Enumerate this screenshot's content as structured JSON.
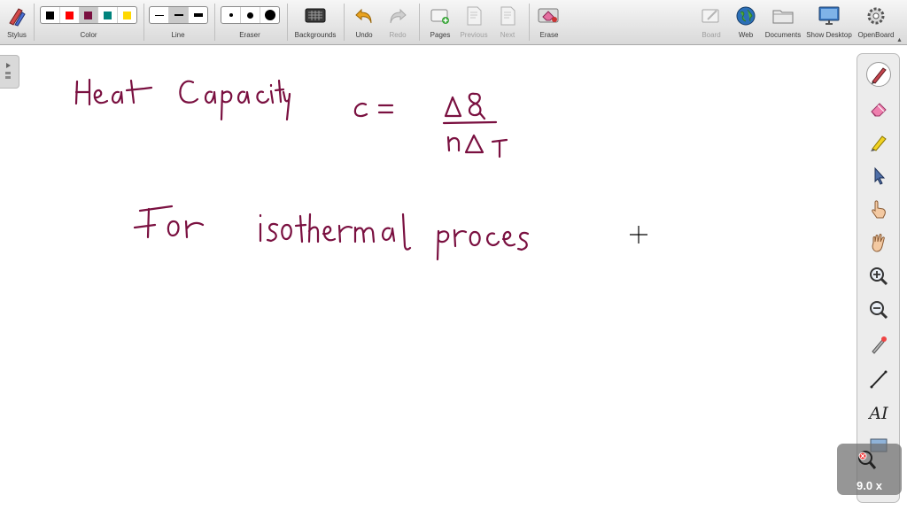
{
  "toolbar": {
    "stylus": "Stylus",
    "color": "Color",
    "line": "Line",
    "eraser": "Eraser",
    "backgrounds": "Backgrounds",
    "undo": "Undo",
    "redo": "Redo",
    "pages": "Pages",
    "previous": "Previous",
    "next": "Next",
    "erase": "Erase",
    "board": "Board",
    "web": "Web",
    "documents": "Documents",
    "show_desktop": "Show Desktop",
    "openboard": "OpenBoard"
  },
  "colors": {
    "palette": [
      "#000000",
      "#ff0000",
      "#7a1040",
      "#00837d",
      "#ffd800"
    ],
    "ink": "#7a1040"
  },
  "canvas": {
    "handwriting": {
      "line1_title": "Heat Capacity",
      "formula_lhs": "c =",
      "formula_numerator": "ΔQ",
      "formula_denominator": "nΔT",
      "line2": "For isothermal process"
    }
  },
  "right_tools": [
    "pen-icon",
    "eraser-icon",
    "highlighter-icon",
    "pointer-icon",
    "hand-pointer-icon",
    "hand-icon",
    "zoom-in-icon",
    "zoom-out-icon",
    "laser-pointer-icon",
    "line-icon",
    "text-icon",
    "capture-icon"
  ],
  "text_tool_label": "AI",
  "zoom": "9.0 x"
}
